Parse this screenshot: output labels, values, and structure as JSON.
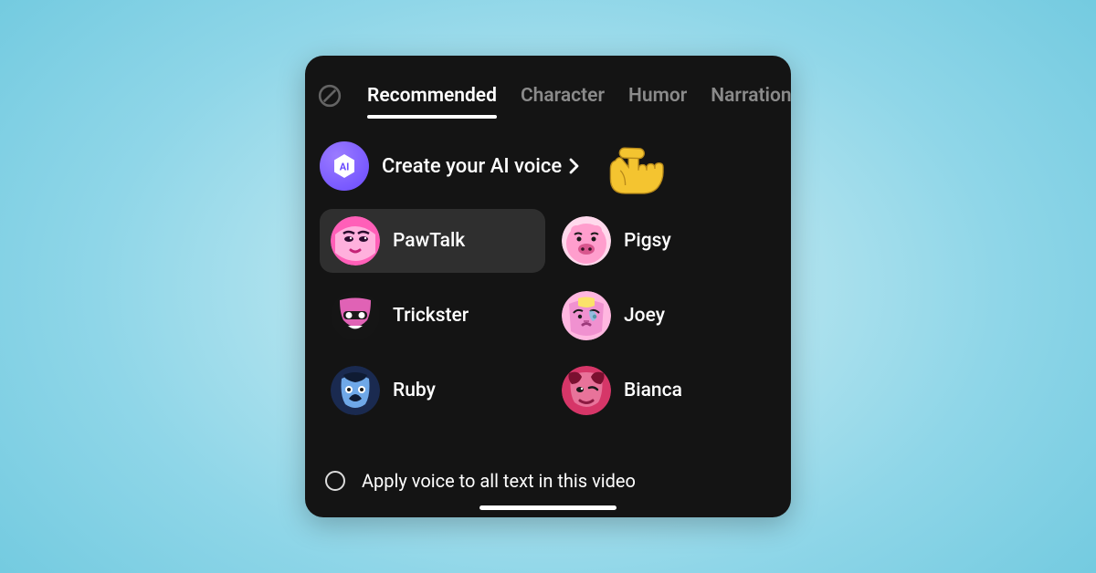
{
  "tabs": {
    "recommended": "Recommended",
    "character": "Character",
    "humor": "Humor",
    "narration": "Narration"
  },
  "create": {
    "label": "Create your AI voice",
    "badge_text": "AI"
  },
  "voices": [
    {
      "name": "PawTalk",
      "selected": true
    },
    {
      "name": "Pigsy",
      "selected": false
    },
    {
      "name": "Trickster",
      "selected": false
    },
    {
      "name": "Joey",
      "selected": false
    },
    {
      "name": "Ruby",
      "selected": false
    },
    {
      "name": "Bianca",
      "selected": false
    }
  ],
  "apply_label": "Apply voice to all text in this video"
}
